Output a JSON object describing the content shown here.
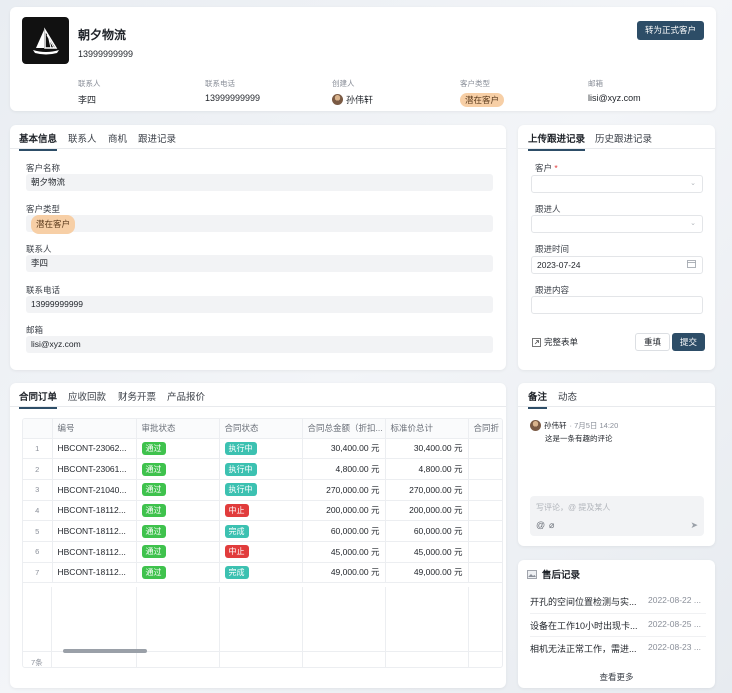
{
  "header": {
    "company_name": "朝夕物流",
    "phone": "13999999999",
    "convert_button": "转为正式客户",
    "meta": [
      {
        "label": "联系人",
        "value": "李四"
      },
      {
        "label": "联系电话",
        "value": "13999999999"
      },
      {
        "label": "创建人",
        "value": "孙伟轩"
      },
      {
        "label": "客户类型",
        "value": "潜在客户"
      },
      {
        "label": "邮箱",
        "value": "lisi@xyz.com"
      }
    ]
  },
  "basic": {
    "tabs": [
      "基本信息",
      "联系人",
      "商机",
      "跟进记录"
    ],
    "fields": [
      {
        "label": "客户名称",
        "value": "朝夕物流"
      },
      {
        "label": "客户类型",
        "value": "潜在客户"
      },
      {
        "label": "联系人",
        "value": "李四"
      },
      {
        "label": "联系电话",
        "value": "13999999999"
      },
      {
        "label": "邮箱",
        "value": "lisi@xyz.com"
      }
    ]
  },
  "follow": {
    "tabs": [
      "上传跟进记录",
      "历史跟进记录"
    ],
    "customer_label": "客户",
    "required_mark": "*",
    "follower_label": "跟进人",
    "time_label": "跟进时间",
    "time_value": "2023-07-24",
    "content_label": "跟进内容",
    "full_form": "完整表单",
    "reset": "重填",
    "submit": "提交"
  },
  "contracts": {
    "tabs": [
      "合同订单",
      "应收回款",
      "财务开票",
      "产品报价"
    ],
    "columns": [
      "编号",
      "审批状态",
      "合同状态",
      "合同总金额（折扣...",
      "标准价总计",
      "合同折"
    ],
    "rows": [
      {
        "idx": "1",
        "code": "HBCONT-23062...",
        "approval": "通过",
        "status": "执行中",
        "total": "30,400.00 元",
        "std": "30,400.00 元"
      },
      {
        "idx": "2",
        "code": "HBCONT-23061...",
        "approval": "通过",
        "status": "执行中",
        "total": "4,800.00 元",
        "std": "4,800.00 元"
      },
      {
        "idx": "3",
        "code": "HBCONT-21040...",
        "approval": "通过",
        "status": "执行中",
        "total": "270,000.00 元",
        "std": "270,000.00 元"
      },
      {
        "idx": "4",
        "code": "HBCONT-18112...",
        "approval": "通过",
        "status": "中止",
        "total": "200,000.00 元",
        "std": "200,000.00 元"
      },
      {
        "idx": "5",
        "code": "HBCONT-18112...",
        "approval": "通过",
        "status": "完成",
        "total": "60,000.00 元",
        "std": "60,000.00 元"
      },
      {
        "idx": "6",
        "code": "HBCONT-18112...",
        "approval": "通过",
        "status": "中止",
        "total": "45,000.00 元",
        "std": "45,000.00 元"
      },
      {
        "idx": "7",
        "code": "HBCONT-18112...",
        "approval": "通过",
        "status": "完成",
        "total": "49,000.00 元",
        "std": "49,000.00 元"
      }
    ],
    "count": "7条"
  },
  "notes": {
    "tabs": [
      "备注",
      "动态"
    ],
    "author": "孙伟轩",
    "time": "· 7月5日 14:20",
    "text": "这是一条有趣的评论",
    "placeholder": "写评论，@ 提及某人"
  },
  "aftersale": {
    "title": "售后记录",
    "items": [
      {
        "text": "开孔的空间位置检测与实...",
        "date": "2022-08-22 ..."
      },
      {
        "text": "设备在工作10小时出现卡...",
        "date": "2022-08-25 ..."
      },
      {
        "text": "相机无法正常工作，需进...",
        "date": "2022-08-23 ..."
      }
    ],
    "more": "查看更多"
  },
  "colors": {
    "accent": "#2d4d67",
    "green": "#3fc24d",
    "teal": "#3cc1b1",
    "red": "#e13c3c",
    "orange_tag": "#f7cfa6"
  }
}
